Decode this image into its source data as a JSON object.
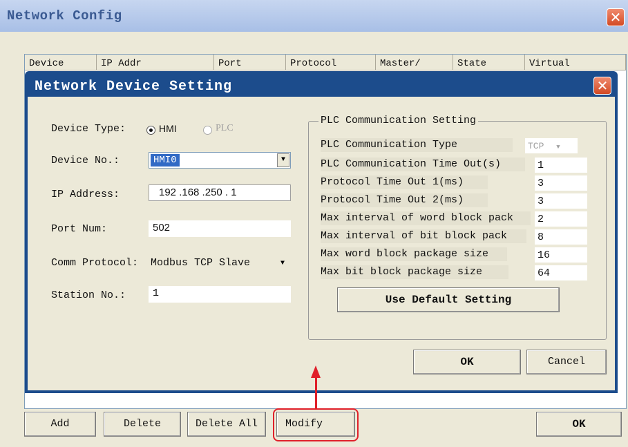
{
  "outer": {
    "title": "Network Config",
    "columns": [
      "Device",
      "IP Addr",
      "Port",
      "Protocol",
      "Master/",
      "State",
      "Virtual"
    ],
    "buttons": {
      "add": "Add",
      "delete": "Delete",
      "delete_all": "Delete All",
      "modify": "Modify",
      "ok": "OK"
    }
  },
  "dialog": {
    "title": "Network Device Setting",
    "labels": {
      "device_type": "Device Type:",
      "device_no": "Device No.:",
      "ip_address": "IP Address:",
      "port_num": "Port Num:",
      "comm_protocol": "Comm Protocol:",
      "station_no": "Station No.:"
    },
    "device_type": {
      "options": [
        "HMI",
        "PLC"
      ],
      "selected": "HMI"
    },
    "device_no": "HMI0",
    "ip_address": "192 .168 .250 . 1",
    "port_num": "502",
    "comm_protocol": "Modbus TCP Slave",
    "station_no": "1",
    "plc_group": {
      "caption": "PLC Communication Setting",
      "rows": [
        {
          "label": "PLC Communication Type",
          "value": "TCP"
        },
        {
          "label": "PLC Communication Time Out(s)",
          "value": "1"
        },
        {
          "label": "Protocol Time Out 1(ms)",
          "value": "3"
        },
        {
          "label": "Protocol Time Out 2(ms)",
          "value": "3"
        },
        {
          "label": "Max interval of word block pack",
          "value": "2"
        },
        {
          "label": "Max interval of bit block pack",
          "value": "8"
        },
        {
          "label": "Max word block package size",
          "value": "16"
        },
        {
          "label": "Max bit block package size",
          "value": "64"
        }
      ],
      "default_button": "Use Default Setting"
    },
    "ok": "OK",
    "cancel": "Cancel"
  },
  "annotation_color": "#e0202a",
  "icons": {
    "close": "close-icon",
    "dropdown": "chevron-down-icon"
  }
}
